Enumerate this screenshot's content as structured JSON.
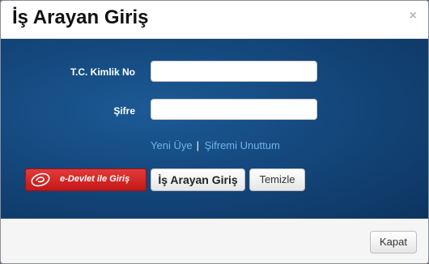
{
  "dialog": {
    "title": "İş Arayan Giriş",
    "close_glyph": "×"
  },
  "form": {
    "tc_label": "T.C. Kimlik No",
    "tc_value": "",
    "password_label": "Şifre",
    "password_value": ""
  },
  "links": {
    "new_member": "Yeni Üye",
    "separator": "|",
    "forgot_password": "Şifremi Unuttum"
  },
  "buttons": {
    "edevlet_label": "e-Devlet ile Giriş",
    "login_label": "İş Arayan Giriş",
    "clear_label": "Temizle",
    "close_label": "Kapat"
  },
  "colors": {
    "body_blue": "#154a80",
    "link_blue": "#6fb4ea",
    "edevlet_red": "#d42020"
  },
  "icons": {
    "close": "close-icon",
    "edevlet_logo": "edevlet-logo-icon"
  }
}
